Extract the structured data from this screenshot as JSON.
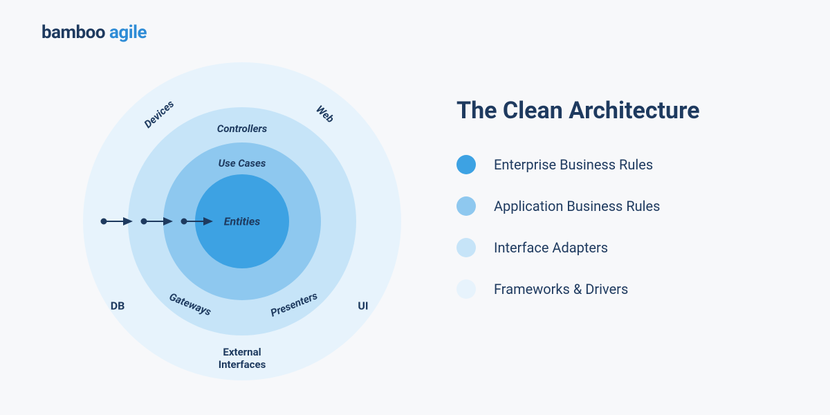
{
  "brand": {
    "word1": "bamboo",
    "word2": "agile"
  },
  "title": "The Clean Architecture",
  "colors": {
    "ring1": "#3da2e3",
    "ring2": "#8ec8ef",
    "ring3": "#c6e4f8",
    "ring4": "#e7f3fc",
    "text": "#1e3a5f"
  },
  "rings": {
    "core": "Entities",
    "r2_top": "Use Cases",
    "r3_top": "Controllers",
    "r3_bl": "Gateways",
    "r3_br": "Presenters",
    "r4_tl": "Devices",
    "r4_tr": "Web",
    "r4_l": "DB",
    "r4_r": "UI",
    "r4_b": "External\nInterfaces"
  },
  "legend": [
    {
      "label": "Enterprise Business Rules",
      "color": "#3da2e3"
    },
    {
      "label": "Application Business Rules",
      "color": "#8ec8ef"
    },
    {
      "label": "Interface Adapters",
      "color": "#c6e4f8"
    },
    {
      "label": "Frameworks & Drivers",
      "color": "#e7f3fc"
    }
  ]
}
